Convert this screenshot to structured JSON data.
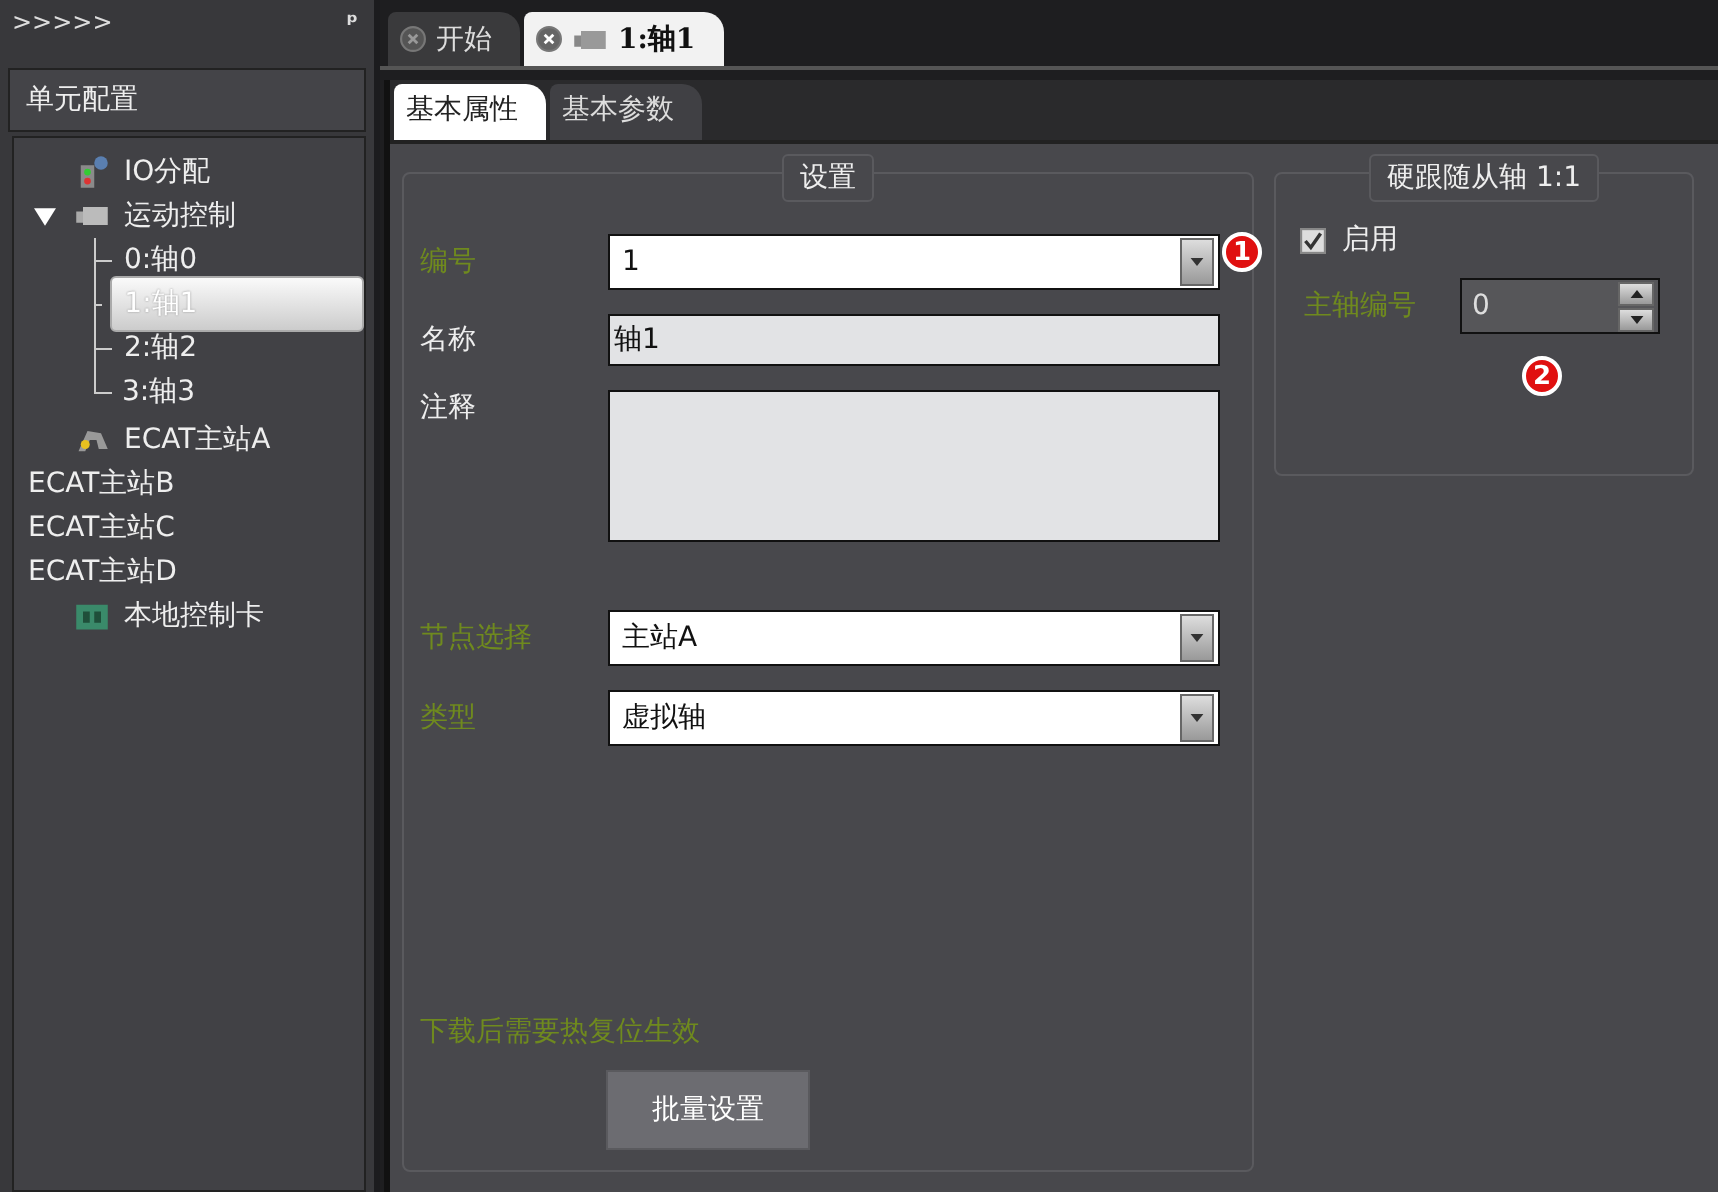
{
  "sidebar": {
    "collapse_label": ">>>>>",
    "pin_label": "ᵖ",
    "title": "单元配置",
    "tree": [
      {
        "label": "IO分配",
        "kind": "io",
        "selected": false
      },
      {
        "label": "运动控制",
        "kind": "motion",
        "expanded": true,
        "selected": false,
        "children": [
          {
            "label": "0:轴0",
            "selected": false
          },
          {
            "label": "1:轴1",
            "selected": true
          },
          {
            "label": "2:轴2",
            "selected": false
          },
          {
            "label": "3:轴3",
            "selected": false
          }
        ]
      },
      {
        "label": "ECAT主站A",
        "kind": "robot",
        "selected": false
      },
      {
        "label": "ECAT主站B",
        "kind": "none",
        "selected": false
      },
      {
        "label": "ECAT主站C",
        "kind": "none",
        "selected": false
      },
      {
        "label": "ECAT主站D",
        "kind": "none",
        "selected": false
      },
      {
        "label": "本地控制卡",
        "kind": "card",
        "selected": false
      }
    ]
  },
  "doc_tabs": [
    {
      "label": "开始",
      "selected": false,
      "icon": false
    },
    {
      "label": "1:轴1",
      "selected": true,
      "icon": true
    }
  ],
  "tabs": [
    {
      "label": "基本属性",
      "selected": true
    },
    {
      "label": "基本参数",
      "selected": false
    }
  ],
  "settings": {
    "title": "设置",
    "fields": [
      {
        "label": "编号",
        "kind": "select",
        "value": "1",
        "highlighted": true
      },
      {
        "label": "名称",
        "kind": "text",
        "value": "轴1",
        "highlighted": false
      },
      {
        "label": "注释",
        "kind": "textarea",
        "highlighted": false
      },
      {
        "label": "节点选择",
        "kind": "select",
        "value": "主站A",
        "highlighted": true
      },
      {
        "label": "类型",
        "kind": "select",
        "value": "虚拟轴",
        "highlighted": true
      }
    ],
    "note": "下载后需要热复位生效",
    "button": "批量设置"
  },
  "follow": {
    "title": "硬跟随从轴 1:1",
    "enable": {
      "label": "启用",
      "checked": true
    },
    "master": {
      "label": "主轴编号",
      "value": "0"
    }
  },
  "annotations": [
    "1",
    "2"
  ]
}
